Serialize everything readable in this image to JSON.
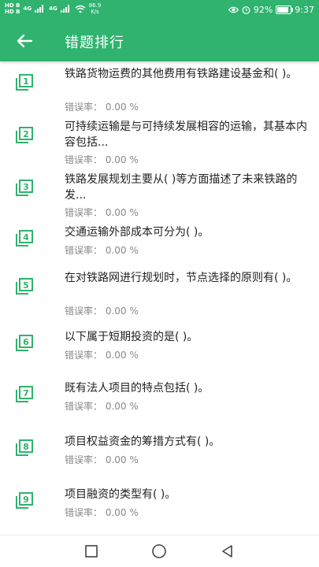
{
  "status": {
    "sim1": "HD",
    "sim1b": "B",
    "sim2": "HD",
    "sim2b": "B",
    "net1": "4G",
    "net2": "4G",
    "speed_value": "86.9",
    "speed_unit": "K/s",
    "battery": "92%",
    "time": "9:37",
    "icons": [
      "eye-icon",
      "alarm-icon"
    ]
  },
  "appbar": {
    "title": "错题排行",
    "back_icon": "arrow-left-icon"
  },
  "colors": {
    "primary": "#2fb36e",
    "icon": "#2fb36e",
    "text": "#222222",
    "subtext": "#888888"
  },
  "questions": [
    {
      "num": "1",
      "text": "铁路货物运费的其他费用有铁路建设基金和( )。",
      "rate": "错误率：  0.00 %"
    },
    {
      "num": "2",
      "text": "可持续运输是与可持续发展相容的运输，其基本内容包括...",
      "rate": "错误率：  0.00 %"
    },
    {
      "num": "3",
      "text": "铁路发展规划主要从( )等方面描述了未来铁路的发...",
      "rate": "错误率：  0.00 %"
    },
    {
      "num": "4",
      "text": "交通运输外部成本可分为( )。",
      "rate": "错误率：  0.00 %"
    },
    {
      "num": "5",
      "text": "在对铁路网进行规划时，节点选择的原则有( )。",
      "rate": "错误率：  0.00 %"
    },
    {
      "num": "6",
      "text": "以下属于短期投资的是( )。",
      "rate": "错误率：  0.00 %"
    },
    {
      "num": "7",
      "text": "既有法人项目的特点包括( )。",
      "rate": "错误率：  0.00 %"
    },
    {
      "num": "8",
      "text": "项目权益资金的筹措方式有( )。",
      "rate": "错误率：  0.00 %"
    },
    {
      "num": "9",
      "text": "项目融资的类型有( )。",
      "rate": "错误率：  0.00 %"
    }
  ],
  "navbar": {
    "icons": [
      "recent-apps-icon",
      "home-icon",
      "back-icon"
    ]
  }
}
